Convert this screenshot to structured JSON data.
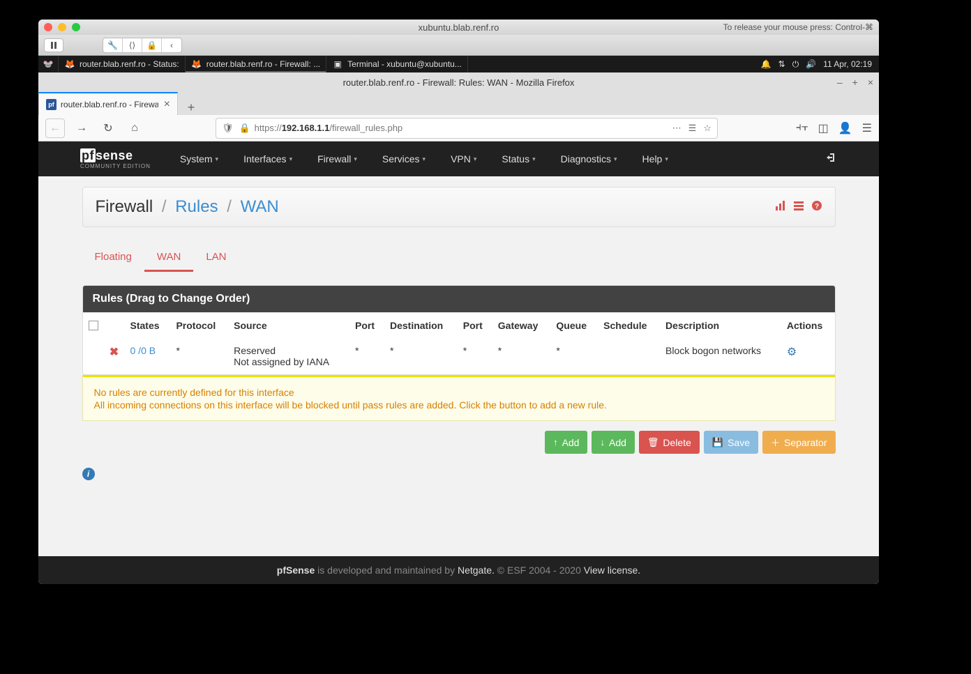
{
  "mac": {
    "title": "xubuntu.blab.renf.ro",
    "release_hint": "To release your mouse press: Control-⌘"
  },
  "ubuntu": {
    "tasks": [
      {
        "label": "router.blab.renf.ro - Status:"
      },
      {
        "label": "router.blab.renf.ro - Firewall: ..."
      },
      {
        "label": "Terminal - xubuntu@xubuntu..."
      }
    ],
    "datetime": "11 Apr, 02:19"
  },
  "firefox": {
    "window_title": "router.blab.renf.ro - Firewall: Rules: WAN - Mozilla Firefox",
    "tab_title": "router.blab.renf.ro - Firewall:",
    "url_prefix": "https://",
    "url_host": "192.168.1.1",
    "url_path": "/firewall_rules.php"
  },
  "pfsense": {
    "logo_main": "sense",
    "logo_prefix": "pf",
    "logo_sub": "COMMUNITY EDITION",
    "menu": [
      "System",
      "Interfaces",
      "Firewall",
      "Services",
      "VPN",
      "Status",
      "Diagnostics",
      "Help"
    ],
    "breadcrumb": {
      "root": "Firewall",
      "mid": "Rules",
      "leaf": "WAN"
    },
    "tabs": [
      {
        "label": "Floating",
        "active": false
      },
      {
        "label": "WAN",
        "active": true
      },
      {
        "label": "LAN",
        "active": false
      }
    ],
    "panel_title": "Rules (Drag to Change Order)",
    "columns": [
      "",
      "",
      "States",
      "Protocol",
      "Source",
      "Port",
      "Destination",
      "Port",
      "Gateway",
      "Queue",
      "Schedule",
      "Description",
      "Actions"
    ],
    "rows": [
      {
        "icon": "block",
        "states": "0 /0 B",
        "protocol": "*",
        "source": "Reserved\nNot assigned by IANA",
        "port1": "*",
        "destination": "*",
        "port2": "*",
        "gateway": "*",
        "queue": "*",
        "schedule": "",
        "description": "Block bogon networks"
      }
    ],
    "alert": {
      "line1": "No rules are currently defined for this interface",
      "line2": "All incoming connections on this interface will be blocked until pass rules are added. Click the button to add a new rule."
    },
    "buttons": {
      "add1": "Add",
      "add2": "Add",
      "delete": "Delete",
      "save": "Save",
      "separator": "Separator"
    },
    "footer": {
      "brand": "pfSense",
      "text1": " is developed and maintained by ",
      "netgate": "Netgate.",
      "copyright": " © ESF 2004 - 2020 ",
      "license": "View license."
    }
  }
}
